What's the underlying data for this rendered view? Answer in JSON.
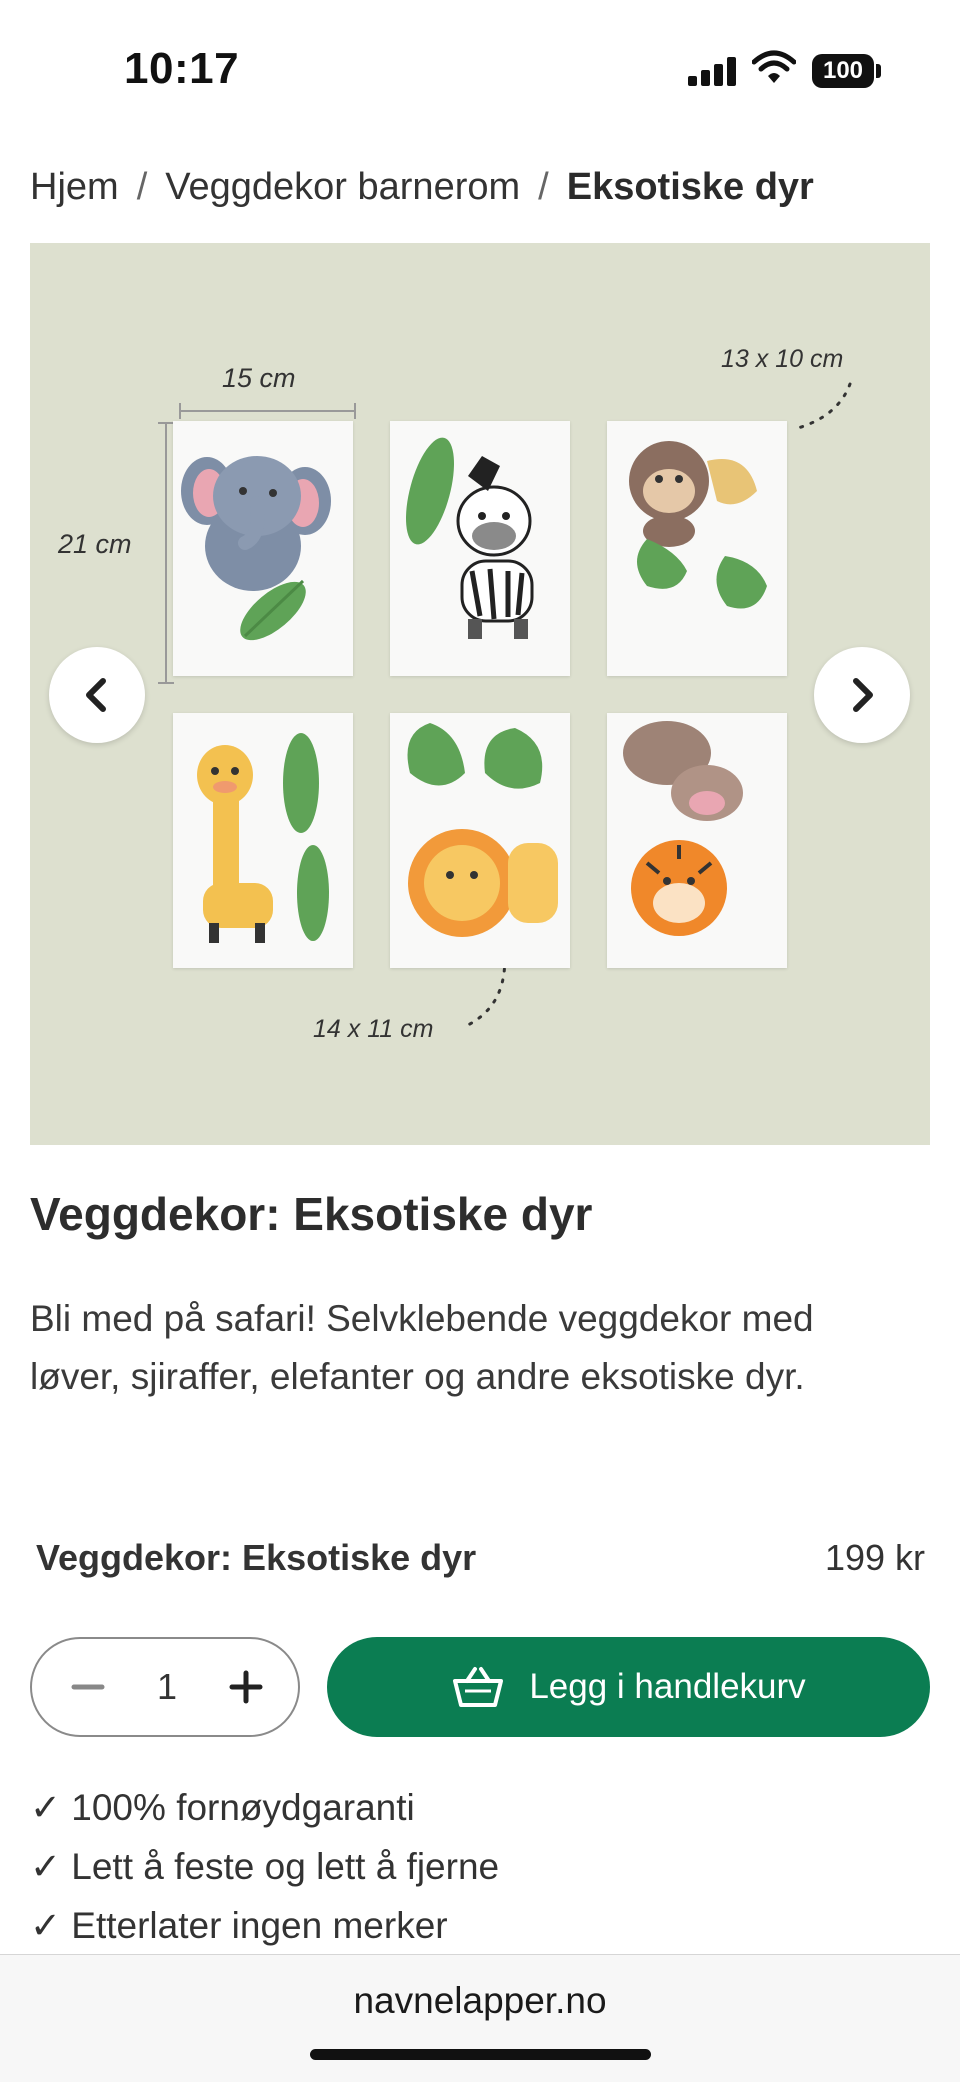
{
  "status_bar": {
    "time": "10:17",
    "battery": "100"
  },
  "breadcrumb": {
    "items": [
      "Hjem",
      "Veggdekor barnerom"
    ],
    "current": "Eksotiske dyr",
    "separator": "/"
  },
  "gallery": {
    "dimensions": {
      "width_label": "15 cm",
      "height_label": "21 cm",
      "small_label": "13 x 10 cm",
      "medium_label": "14 x 11 cm"
    },
    "stickers": [
      "elephant",
      "zebra",
      "monkey",
      "giraffe",
      "lion",
      "hippo-and-tiger"
    ],
    "background_color": "#dde0cf"
  },
  "product": {
    "title": "Veggdekor: Eksotiske dyr",
    "description": "Bli med på safari! Selvklebende veggdekor med løver, sjiraffer, elefanter og andre eksotiske dyr.",
    "variant_name": "Veggdekor: Eksotiske dyr",
    "price": "199 kr",
    "quantity": "1",
    "add_to_cart_label": "Legg i handlekurv",
    "accent_color": "#0b7d52",
    "usps": [
      "✓ 100% fornøydgaranti",
      "✓ Lett å feste og lett å fjerne",
      "✓ Etterlater ingen merker"
    ]
  },
  "browser": {
    "url": "navnelapper.no"
  }
}
